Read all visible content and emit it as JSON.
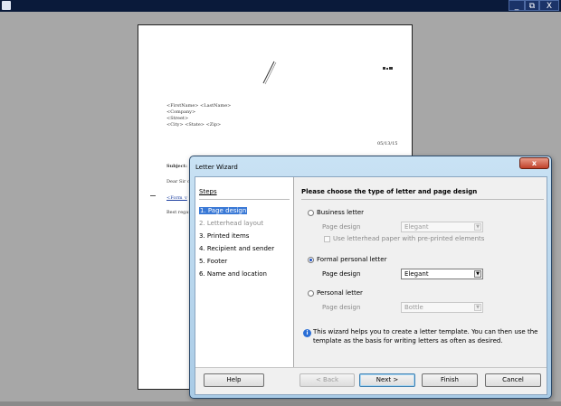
{
  "window": {
    "minimize": "_",
    "restore": "⧉",
    "close": "X"
  },
  "letter_preview": {
    "address_lines": [
      "<FirstName> <LastName>",
      "<Company>",
      "<Street>",
      "<City> <State> <Zip>"
    ],
    "date": "05/13/15",
    "subject": "Subject: <S",
    "salutation": "Dear Sir or",
    "field": "<Form_v",
    "closing": "Best regard"
  },
  "dialog": {
    "title": "Letter Wizard",
    "close": "x",
    "steps_heading": "Steps",
    "steps": [
      {
        "label": "1. Page design",
        "state": "active"
      },
      {
        "label": "2. Letterhead layout",
        "state": "disabled"
      },
      {
        "label": "3. Printed items",
        "state": "normal"
      },
      {
        "label": "4. Recipient and sender",
        "state": "normal"
      },
      {
        "label": "5. Footer",
        "state": "normal"
      },
      {
        "label": "6. Name and location",
        "state": "normal"
      }
    ],
    "heading": "Please choose the type of letter and page design",
    "options": {
      "business": {
        "label": "Business letter",
        "selected": false,
        "page_design_label": "Page design",
        "page_design_value": "Elegant",
        "enabled": false
      },
      "letterhead_checkbox": {
        "label": "Use letterhead paper with pre-printed elements",
        "checked": false,
        "enabled": false
      },
      "formal": {
        "label": "Formal personal letter",
        "selected": true,
        "page_design_label": "Page design",
        "page_design_value": "Elegant",
        "enabled": true
      },
      "personal": {
        "label": "Personal letter",
        "selected": false,
        "page_design_label": "Page design",
        "page_design_value": "Bottle",
        "enabled": false
      }
    },
    "info": "This wizard helps you to create a letter template. You can then use the template as the basis for writing letters as often as desired.",
    "buttons": {
      "help": "Help",
      "back": "< Back",
      "next": "Next >",
      "finish": "Finish",
      "cancel": "Cancel"
    }
  }
}
